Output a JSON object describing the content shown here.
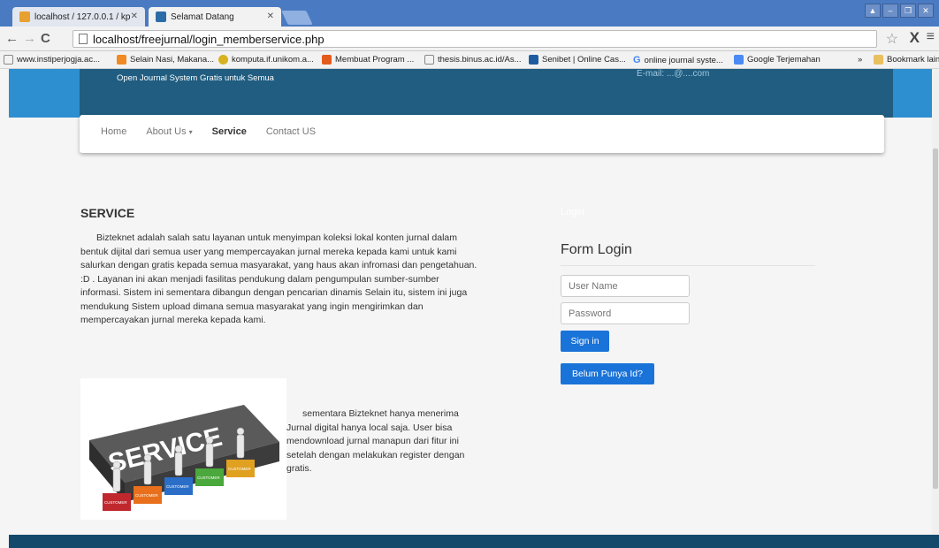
{
  "browser": {
    "tabs": [
      {
        "label": "localhost / 127.0.0.1 / kp"
      },
      {
        "label": "Selamat Datang"
      }
    ],
    "address": "localhost/freejurnal/login_memberservice.php",
    "bookmarks": [
      "www.instiperjogja.ac...",
      "Selain Nasi, Makana...",
      "komputa.if.unikom.a...",
      "Membuat Program ...",
      "thesis.binus.ac.id/As...",
      "Senibet | Online Cas...",
      "online journal syste...",
      "Google Terjemahan"
    ],
    "overflow_label": "»",
    "bookmarks_folder": "Bookmark lain"
  },
  "header": {
    "tagline": "Open Journal System Gratis untuk Semua",
    "email": "E-mail: ...@....com"
  },
  "nav": {
    "items": [
      "Home",
      "About Us",
      "Service",
      "Contact US"
    ],
    "about_caret": "▾"
  },
  "main": {
    "title": "SERVICE",
    "paragraph": "Bizteknet adalah salah satu layanan untuk menyimpan koleksi lokal konten jurnal dalam bentuk dijital dari semua user yang mempercayakan jurnal mereka kepada kami untuk kami salurkan dengan gratis kepada semua masyarakat, yang haus akan infromasi dan pengetahuan. :D . Layanan ini akan menjadi fasilitas pendukung dalam pengumpulan sumber-sumber informasi. Sistem ini sementara dibangun dengan pencarian dinamis Selain itu, sistem ini juga mendukung Sistem upload dimana semua masyarakat yang ingin mengirimkan dan mempercayakan jurnal mereka kepada kami.",
    "caption": "sementara Bizteknet hanya menerima Jurnal digital hanya local saja. User bisa mendownload jurnal manapun dari fitur ini setelah dengan melakukan register dengan gratis.",
    "image_word": "SERVICE",
    "image_block_labels": [
      "CUSTOMER",
      "CUSTOMER",
      "CUSTOMER",
      "CUSTOMER",
      "CUSTOMER"
    ]
  },
  "login": {
    "ghost_title": "Login",
    "title": "Form Login",
    "username_placeholder": "User Name",
    "password_placeholder": "Password",
    "signin_label": "Sign in",
    "register_label": "Belum Punya Id?"
  },
  "colors": {
    "header_blue": "#2d8fd0",
    "header_dark": "#205d80",
    "button_blue": "#1a73d8",
    "footer": "#134a6c"
  }
}
